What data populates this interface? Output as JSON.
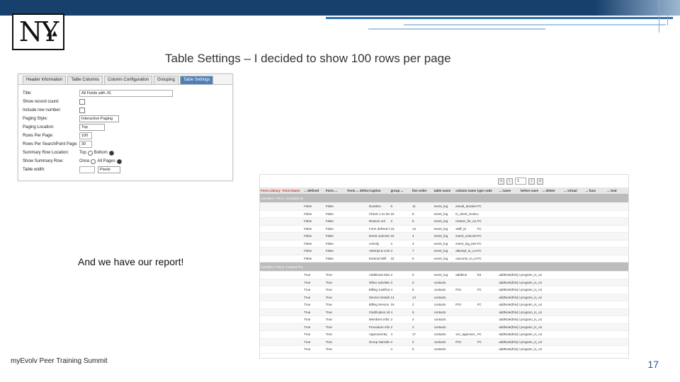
{
  "logo": {
    "text": "NY"
  },
  "slide": {
    "title": "Table Settings – I decided to show 100 rows per page",
    "caption": "And we have our report!",
    "footer": "myEvolv Peer Training Summit",
    "page_number": "17"
  },
  "settings": {
    "tabs": [
      "Header Information",
      "Table Columns",
      "Column Configuration",
      "Grouping",
      "Table Settings"
    ],
    "active_tab": "Table Settings",
    "fields": {
      "title_label": "Title:",
      "title_value": "All Fields with JS",
      "show_record_count_label": "Show record count:",
      "include_row_number_label": "Include row number:",
      "paging_style_label": "Paging Style:",
      "paging_style_value": "Interactive Paging",
      "paging_location_label": "Paging Location:",
      "paging_location_value": "Top",
      "rows_per_page_label": "Rows Per Page:",
      "rows_per_page_value": "100",
      "rows_per_searchpoint_label": "Rows Per SearchPoint Page:",
      "rows_per_searchpoint_value": "30",
      "summary_row_location_label": "Summary Row Location:",
      "summary_top": "Top",
      "summary_bottom": "Bottom",
      "show_summary_row_label": "Show Summary Row:",
      "summary_once": "Once",
      "summary_all": "All Pages",
      "table_width_label": "Table width:",
      "table_width_unit": "Pixels"
    }
  },
  "report": {
    "pager_page": "1",
    "columns": [
      "Form Library",
      "Form Name",
      "... defined",
      "Form ...",
      "Form ... defined",
      "Caption",
      "group ...",
      "line order",
      "table name",
      "column name",
      "type code",
      "... name",
      "before save",
      "... delete",
      "... virtual",
      "... func",
      "... bod"
    ],
    "groups": [
      {
        "labels": [
          "Activities > People",
          "1. Complete Service Entry"
        ],
        "rows": [
          [
            "",
            "",
            "False",
            "False",
            "",
            "Duration",
            "6",
            "11",
            "event_log",
            "actual_duration",
            "FC",
            "",
            "",
            "",
            "",
            "",
            ""
          ],
          [
            "",
            "",
            "False",
            "False",
            "",
            "Check 1 no less",
            "22",
            "8",
            "event_log",
            "is_client_involved",
            "L",
            "",
            "",
            "",
            "",
            "",
            ""
          ],
          [
            "",
            "",
            "False",
            "False",
            "",
            "Reason not",
            "2",
            "5",
            "event_log",
            "reason_for_no_form_2",
            "FC",
            "",
            "",
            "",
            "",
            "",
            ""
          ],
          [
            "",
            "",
            "False",
            "False",
            "",
            "Form defined by",
            "15",
            "13",
            "event_log",
            "staff_id",
            "FC",
            "",
            "",
            "",
            "",
            "",
            ""
          ],
          [
            "",
            "",
            "False",
            "False",
            "",
            "Event outcome",
            "22",
            "4",
            "event_log",
            "event_outcome_id",
            "FC",
            "",
            "",
            "",
            "",
            "",
            ""
          ],
          [
            "",
            "",
            "False",
            "False",
            "",
            "Activity",
            "2",
            "3",
            "event_log",
            "event_log_item_id",
            "FC",
            "",
            "",
            "",
            "",
            "",
            ""
          ],
          [
            "",
            "",
            "False",
            "False",
            "",
            "Attempt & contact",
            "2",
            "7",
            "event_log",
            "attempt_to_contact_id",
            "FC",
            "",
            "",
            "",
            "",
            "",
            ""
          ],
          [
            "",
            "",
            "False",
            "False",
            "",
            "Entered Will",
            "22",
            "6",
            "event_log",
            "outcome_to_event",
            "FC",
            "",
            "",
            "",
            "",
            "",
            ""
          ]
        ]
      },
      {
        "labels": [
          "Activities > People",
          "2. Contact Program Intro Form"
        ],
        "rows": [
          [
            "",
            "",
            "True",
            "True",
            "",
            "Additional Start and Stop Times",
            "2",
            "5",
            "event_log",
            "addtime",
            "D4",
            "addNote(this);if(s.Form)",
            "program_is_AdmNote(True)Field",
            "",
            "",
            "",
            ""
          ],
          [
            "",
            "",
            "True",
            "True",
            "",
            "Other activities",
            "2",
            "2",
            "contacts",
            "",
            "",
            "addNote(this);if(s.Form)",
            "program_is_AdmNote(True)Field",
            "",
            "",
            "",
            ""
          ],
          [
            "",
            "",
            "True",
            "True",
            "",
            "Billing Justifications of Care",
            "4",
            "6",
            "contacts",
            "PGI",
            "FC",
            "addNote(this);if(s.Form)",
            "program_is_AdmNote(True)Field",
            "",
            "",
            "",
            ""
          ],
          [
            "",
            "",
            "True",
            "True",
            "",
            "Service Details",
            "14",
            "14",
            "contacts",
            "",
            "",
            "addNote(this);if(s.Form)",
            "program_is_AdmNote(True)Field",
            "",
            "",
            "",
            ""
          ],
          [
            "",
            "",
            "True",
            "True",
            "",
            "Billing Service Details Conclusion",
            "19",
            "2",
            "contacts",
            "PGI",
            "FC",
            "addNote(this);if(s.Form)",
            "program_is_AdmNote(True)Field",
            "",
            "",
            "",
            ""
          ],
          [
            "",
            "",
            "True",
            "True",
            "",
            "Clarification information",
            "4",
            "6",
            "contacts",
            "",
            "",
            "addNote(this);if(s.Form)",
            "program_is_AdmNote(True)Field",
            "",
            "",
            "",
            ""
          ],
          [
            "",
            "",
            "True",
            "True",
            "",
            "Members Information",
            "2",
            "2",
            "contacts",
            "",
            "",
            "addNote(this);if(s.Form)",
            "program_is_AdmNote(True)Field",
            "",
            "",
            "",
            ""
          ],
          [
            "",
            "",
            "True",
            "True",
            "",
            "Procedure Information",
            "2",
            "2",
            "contacts",
            "",
            "",
            "addNote(this);if(s.Form)",
            "program_is_AdmNote(True)Field",
            "",
            "",
            "",
            ""
          ],
          [
            "",
            "",
            "True",
            "True",
            "",
            "Approved By",
            "4",
            "17",
            "contacts",
            "svc_approver_id",
            "FC",
            "addNote(this);if(s.Form)",
            "program_is_AdmNote(True)Field",
            "",
            "",
            "",
            ""
          ],
          [
            "",
            "",
            "True",
            "True",
            "",
            "Group Narrative",
            "2",
            "2",
            "contacts",
            "PGI",
            "FC",
            "addNote(this);if(s.Form)",
            "program_is_AdmNote(True)Field",
            "",
            "",
            "",
            ""
          ],
          [
            "",
            "",
            "True",
            "True",
            "",
            "",
            "4",
            "6",
            "contacts",
            "",
            "",
            "addNote(this);if(s.Form)",
            "program_is_AdmNote(True)Field",
            "",
            "",
            "",
            ""
          ]
        ]
      }
    ]
  }
}
